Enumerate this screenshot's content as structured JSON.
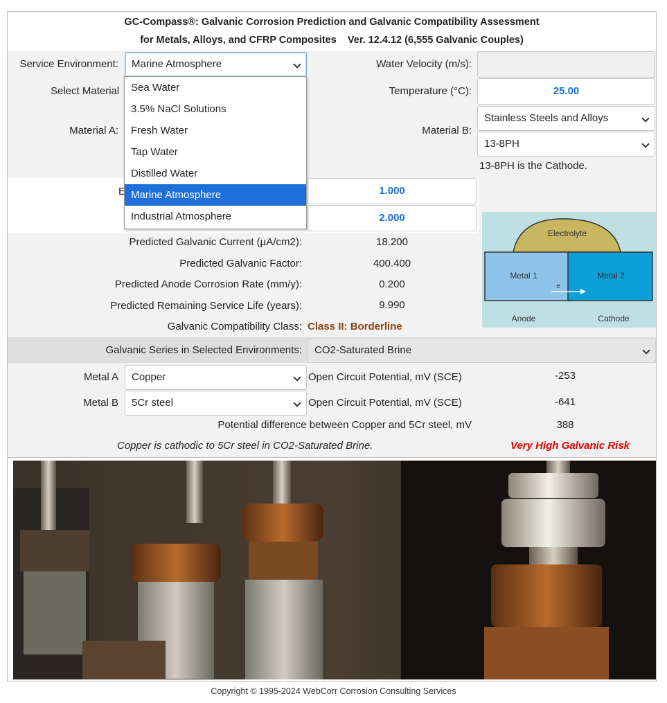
{
  "header": {
    "title_line1": "GC-Compass®: Galvanic Corrosion Prediction and Galvanic Compatibility Assessment",
    "title_line2": "for Metals, Alloys, and CFRP Composites    Ver. 12.4.12 (6,555 Galvanic Couples)"
  },
  "environment": {
    "label": "Service Environment:",
    "selected": "Marine Atmosphere",
    "options": [
      "Sea Water",
      "3.5% NaCl Solutions",
      "Fresh Water",
      "Tap Water",
      "Distilled Water",
      "Marine Atmosphere",
      "Industrial Atmosphere"
    ]
  },
  "velocity": {
    "label": "Water Velocity (m/s):",
    "value": ""
  },
  "select_material": {
    "label": "Select Material"
  },
  "temperature": {
    "label": "Temperature (°C):",
    "value": "25.00"
  },
  "material_a": {
    "label": "Material A:"
  },
  "material_b": {
    "label": "Material B:",
    "category": "Stainless Steels and Alloys",
    "alloy": "13-8PH",
    "role_note": "13-8PH is the Cathode."
  },
  "area_inputs": {
    "label_fragment": "E",
    "value1": "1.000",
    "value2": "2.000"
  },
  "results": {
    "current_label": "Predicted Galvanic Current (µA/cm2):",
    "current_value": "18.200",
    "factor_label": "Predicted Galvanic Factor:",
    "factor_value": "400.400",
    "rate_label": "Predicted Anode Corrosion Rate (mm/y):",
    "rate_value": "0.200",
    "life_label": "Predicted Remaining Service Life (years):",
    "life_value": "9.990",
    "class_label": "Galvanic Compatibility Class:",
    "class_value": "Class II: Borderline"
  },
  "diagram": {
    "electrolyte": "Electrolyte",
    "metal1": "Metal 1",
    "metal2": "Metal 2",
    "electron": "e",
    "anode": "Anode",
    "cathode": "Cathode"
  },
  "series": {
    "label": "Galvanic Series in Selected Environments:",
    "selected": "CO2-Saturated Brine",
    "metal_a_label": "Metal A",
    "metal_a": "Copper",
    "metal_b_label": "Metal B",
    "metal_b": "5Cr steel",
    "ocp_label": "Open Circuit Potential, mV (SCE)",
    "ocp_a": "-253",
    "ocp_b": "-641",
    "diff_label": "Potential difference between Copper and 5Cr steel, mV",
    "diff_value": "388",
    "conclusion": "Copper is cathodic to 5Cr steel in CO2-Saturated Brine.",
    "risk": "Very High Galvanic Risk"
  },
  "footer": {
    "copyright": "Copyright © 1995-2024 WebCorr Corrosion Consulting Services"
  },
  "colors": {
    "accent": "#1e6fd9",
    "value_blue": "#1a6fd6",
    "risk_red": "#e00000",
    "class_brown": "#8b4513"
  }
}
